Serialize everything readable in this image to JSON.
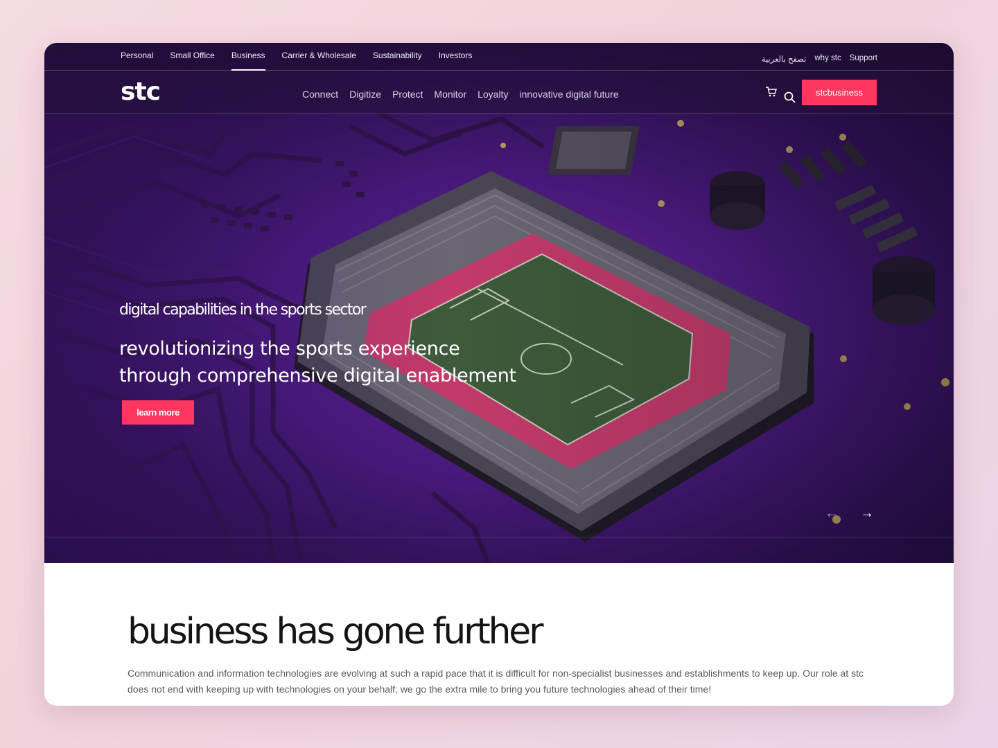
{
  "utility": {
    "tabs": [
      {
        "label": "Personal"
      },
      {
        "label": "Small Office"
      },
      {
        "label": "Business"
      },
      {
        "label": "Carrier & Wholesale"
      },
      {
        "label": "Sustainability"
      },
      {
        "label": "Investors"
      }
    ],
    "active_tab": "Business",
    "arabic": "تصفح بالعربية",
    "why": "why stc",
    "support": "Support"
  },
  "nav": {
    "logo": "stc",
    "links": [
      "Connect",
      "Digitize",
      "Protect",
      "Monitor",
      "Loyalty",
      "innovative digital future"
    ],
    "cta": "stcbusiness",
    "cart_icon": "cart-icon",
    "search_icon": "search-icon"
  },
  "hero": {
    "eyebrow": "digital capabilities in the sports sector",
    "headline": "revolutionizing the sports experience through comprehensive digital enablement",
    "button": "learn more",
    "prev_icon": "arrow-left-icon",
    "next_icon": "arrow-right-icon"
  },
  "section": {
    "title": "business has gone further",
    "body": "Communication and information technologies are evolving at such a rapid pace that it is difficult for non-specialist businesses and establishments to keep up. Our role at stc does not end with keeping up with technologies on your behalf; we go the extra mile to bring you future technologies ahead of their time!"
  },
  "colors": {
    "accent": "#ff375e",
    "hero_purple": "#4a1a7e",
    "pitch_track": "#c23a6a",
    "pitch_grass": "#3e5a3a"
  }
}
